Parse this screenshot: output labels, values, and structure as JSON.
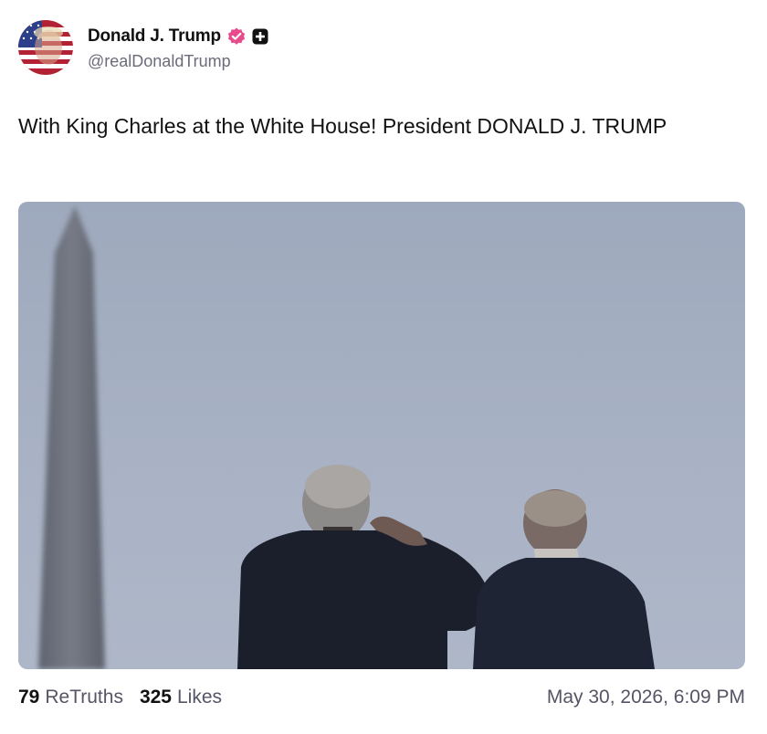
{
  "author": {
    "display_name": "Donald J. Trump",
    "handle": "@realDonaldTrump",
    "verified_icon": "verified-badge-icon",
    "gov_icon": "government-badge-icon",
    "verified_color": "#e84a8c"
  },
  "post": {
    "text": "With King Charles at the White House! President DONALD J. TRUMP"
  },
  "stats": {
    "retruths_count": "79",
    "retruths_label": "ReTruths",
    "likes_count": "325",
    "likes_label": "Likes"
  },
  "timestamp": "May 30, 2026, 6:09 PM"
}
